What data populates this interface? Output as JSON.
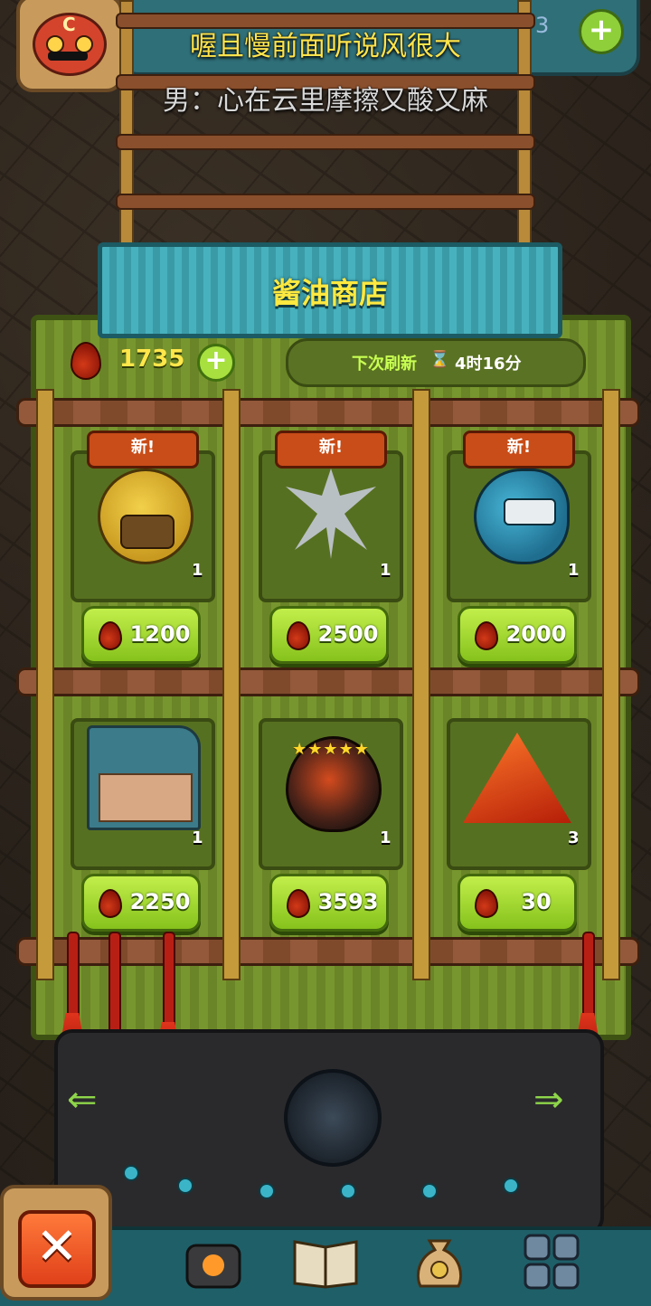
{
  "lyrics": {
    "line1": "喔且慢前面听说风很大",
    "line2": "男：心在云里摩擦又酸又麻"
  },
  "top_bar": {
    "count_partial": "3",
    "plus_label": "+",
    "avatar_letter": "C"
  },
  "shop": {
    "title": "酱油商店",
    "currency_amount": "1735",
    "add_currency_label": "+",
    "refresh_label": "下次刷新",
    "hourglass_icon": "⌛",
    "refresh_time": "4时16分",
    "new_badge": "新!",
    "items": [
      {
        "icon": "yellow-chicken-monster-icon",
        "badge": "新!",
        "quantity": "1",
        "price": "1200"
      },
      {
        "icon": "spiky-gray-monster-icon",
        "badge": "新!",
        "quantity": "1",
        "price": "2500"
      },
      {
        "icon": "blue-fish-monster-icon",
        "badge": "新!",
        "quantity": "1",
        "price": "2000"
      },
      {
        "icon": "monster-house-icon",
        "badge": "",
        "quantity": "1",
        "price": "2250"
      },
      {
        "icon": "lava-egg-icon",
        "badge": "",
        "quantity": "1",
        "price": "3593",
        "stars": "★★★★★"
      },
      {
        "icon": "lava-gem-icon",
        "badge": "",
        "quantity": "3",
        "price": "30"
      }
    ]
  },
  "nav": {
    "left_arrow": "⇐",
    "right_arrow": "⇒"
  },
  "bottom_bar": {
    "close_label": "✕",
    "tabs": [
      "furnace-icon",
      "book-icon",
      "money-bag-icon",
      "grid-icon"
    ]
  },
  "colors": {
    "title_yellow": "#ffe940",
    "panel_green": "#6d8a2a",
    "button_green": "#a8e03f",
    "badge_red": "#c84d18",
    "teal": "#3fa5b2"
  }
}
